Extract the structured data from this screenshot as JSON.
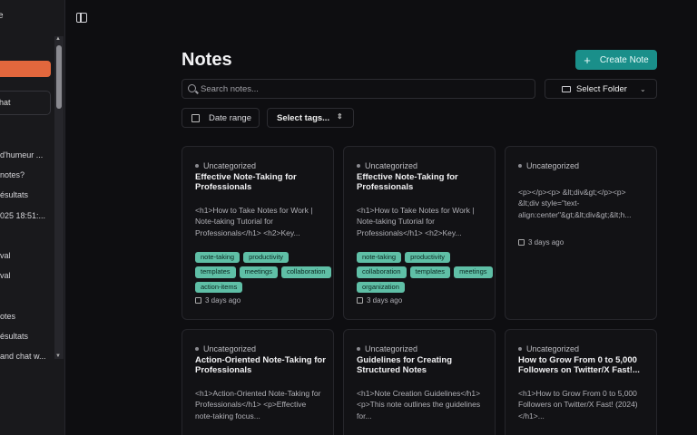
{
  "sidebar": {
    "title": "e",
    "chat_label": "hat",
    "items": [
      {
        "text": "d'humeur ..."
      },
      {
        "text": "notes?"
      },
      {
        "text": "ésultats"
      },
      {
        "text": "025 18:51:..."
      },
      {
        "text": "val"
      },
      {
        "text": "val"
      },
      {
        "text": "otes"
      },
      {
        "text": "ésultats"
      },
      {
        "text": "and chat w..."
      }
    ]
  },
  "header": {
    "title": "Notes",
    "create_label": "Create Note"
  },
  "search": {
    "placeholder": "Search notes..."
  },
  "filters": {
    "folder_label": "Select Folder",
    "date_label": "Date range",
    "tags_label": "Select tags..."
  },
  "notes": [
    {
      "category": "Uncategorized",
      "title": "Effective Note-Taking for Professionals",
      "excerpt": "<h1>How to Take Notes for Work | Note-taking Tutorial for Professionals</h1> <h2>Key...",
      "tags": [
        "note-taking",
        "productivity",
        "templates",
        "meetings",
        "collaboration",
        "action-items"
      ],
      "date": "3 days ago"
    },
    {
      "category": "Uncategorized",
      "title": "Effective Note-Taking for Professionals",
      "excerpt": "<h1>How to Take Notes for Work | Note-taking Tutorial for Professionals</h1> <h2>Key...",
      "tags": [
        "note-taking",
        "productivity",
        "collaboration",
        "templates",
        "meetings",
        "organization"
      ],
      "date": "3 days ago"
    },
    {
      "category": "Uncategorized",
      "title": "",
      "excerpt": "<p></p><p> &lt;div&gt;</p><p> &lt;div style=\"text-align:center\"&gt;&lt;div&gt;&lt;h...",
      "tags": [],
      "date": "3 days ago"
    },
    {
      "category": "Uncategorized",
      "title": "Action-Oriented Note-Taking for Professionals",
      "excerpt": "<h1>Action-Oriented Note-Taking for Professionals</h1> <p>Effective note-taking focus...",
      "tags": [],
      "date": ""
    },
    {
      "category": "Uncategorized",
      "title": "Guidelines for Creating Structured Notes",
      "excerpt": "<h1>Note Creation Guidelines</h1> <p>This note outlines the guidelines for...",
      "tags": [],
      "date": ""
    },
    {
      "category": "Uncategorized",
      "title": "How to Grow From 0 to 5,000 Followers on Twitter/X Fast!...",
      "excerpt": "<h1>How to Grow From 0 to 5,000 Followers on Twitter/X Fast! (2024)</h1>...",
      "tags": [],
      "date": ""
    }
  ]
}
